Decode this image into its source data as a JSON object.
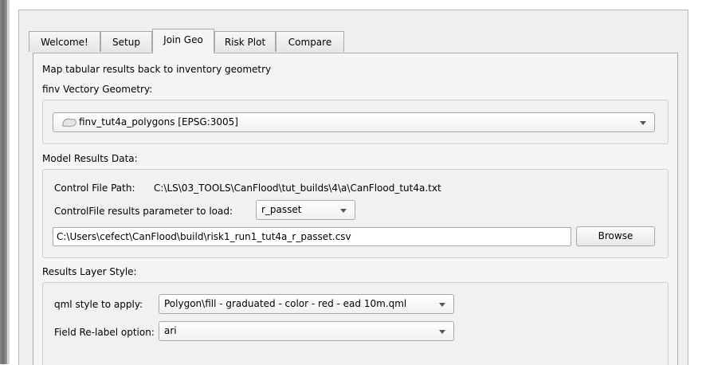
{
  "tabs": [
    {
      "label": "Welcome!"
    },
    {
      "label": "Setup"
    },
    {
      "label": "Join Geo"
    },
    {
      "label": "Risk Plot"
    },
    {
      "label": "Compare"
    }
  ],
  "join_geo": {
    "description": "Map tabular results back to inventory geometry",
    "finv_label": "finv Vectory Geometry:",
    "finv_layer": "finv_tut4a_polygons [EPSG:3005]",
    "model_results_label": "Model Results Data:",
    "control_file_path_label": "Control File Path:",
    "control_file_path_value": "C:\\LS\\03_TOOLS\\CanFlood\\tut_builds\\4\\a\\CanFlood_tut4a.txt",
    "param_label": "ControlFile results parameter to load:",
    "param_value": "r_passet",
    "results_file_path": "C:\\Users\\cefect\\CanFlood\\build\\risk1_run1_tut4a_r_passet.csv",
    "browse_label": "Browse",
    "layer_style_label": "Results Layer Style:",
    "qml_label": "qml style to apply:",
    "qml_value": "Polygon\\fill - graduated - color - red - ead 10m.qml",
    "relabel_label": "Field Re-label option:",
    "relabel_value": "ari"
  }
}
